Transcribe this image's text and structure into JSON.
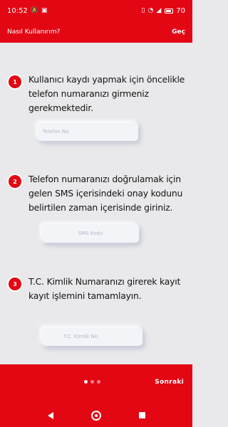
{
  "status": {
    "time": "10:52",
    "battery": "70",
    "icons": [
      "do-not-disturb-icon",
      "screenshot-icon",
      "vibrate-icon",
      "wifi-icon",
      "signal-icon",
      "battery-icon"
    ]
  },
  "header": {
    "title": "Nasıl Kullanırım?",
    "skip_label": "Geç"
  },
  "steps": [
    {
      "number": "1",
      "text": "Kullanıcı kaydı yapmak için öncelikle telefon numaranızı girmeniz gerekmektedir.",
      "field_label": "Telefon No"
    },
    {
      "number": "2",
      "text": "Telefon numaranızı doğrulamak için gelen SMS içerisindeki onay kodunu belirtilen zaman içerisinde giriniz.",
      "field_label": "SMS Kodu"
    },
    {
      "number": "3",
      "text": "T.C. Kimlik Numaranızı girerek kayıt kayıt işlemini tamamlayın.",
      "field_label": "T.C. Kimlik No"
    }
  ],
  "footer": {
    "next_label": "Sonraki",
    "page_count": 3,
    "active_page": 1
  },
  "colors": {
    "brand_red": "#e30613",
    "background": "#e9e9eb"
  }
}
